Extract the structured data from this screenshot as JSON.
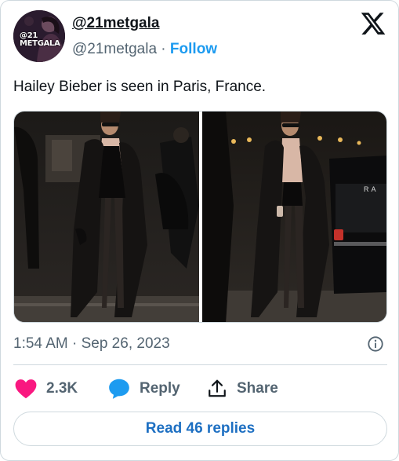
{
  "author": {
    "display_name": "@21metgala",
    "handle": "@21metgala",
    "separator": " · ",
    "follow_label": "Follow",
    "avatar_label_line1": "@21",
    "avatar_label_line2": "METGALA"
  },
  "tweet": {
    "text": "Hailey Bieber is seen in Paris, France.",
    "timestamp": "1:54 AM · Sep 26, 2023"
  },
  "media": {
    "count": 2,
    "photos": [
      "photo-1",
      "photo-2"
    ],
    "car_badge_text": "RA"
  },
  "actions": {
    "likes": "2.3K",
    "reply_label": "Reply",
    "share_label": "Share"
  },
  "read_replies_label": "Read 46 replies",
  "icons": {
    "brand": "x-logo-icon",
    "like": "heart-icon",
    "reply": "speech-bubble-icon",
    "share": "share-upload-icon",
    "info": "info-icon"
  },
  "colors": {
    "accent": "#1d9bf0",
    "like": "#f91880",
    "secondary_text": "#536471",
    "border": "#cfd9de"
  }
}
